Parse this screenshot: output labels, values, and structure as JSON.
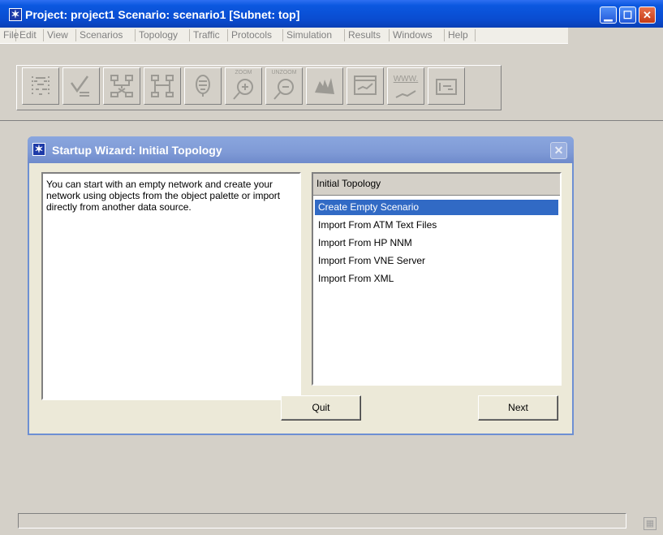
{
  "window": {
    "title": "Project: project1 Scenario: scenario1  [Subnet: top]",
    "icon": "star-icon",
    "controls": [
      "minimize-icon",
      "maximize-icon",
      "close-icon"
    ]
  },
  "menu": [
    {
      "label": "File"
    },
    {
      "label": "Edit"
    },
    {
      "label": "View"
    },
    {
      "label": "Scenarios"
    },
    {
      "label": "Topology"
    },
    {
      "label": "Traffic"
    },
    {
      "label": "Protocols"
    },
    {
      "label": "Simulation"
    },
    {
      "label": "Results"
    },
    {
      "label": "Windows"
    },
    {
      "label": "Help"
    }
  ],
  "toolbar": {
    "zoom_label": "ZOOM",
    "unzoom_label": "UNZOOM",
    "www_label": "WWW.",
    "buttons": [
      {
        "icon": "open-palette-icon"
      },
      {
        "icon": "check-links-icon"
      },
      {
        "icon": "fail-link-icon"
      },
      {
        "icon": "recover-link-icon"
      },
      {
        "icon": "return-parent-icon"
      },
      {
        "icon": "zoom-in-icon"
      },
      {
        "icon": "zoom-out-icon"
      },
      {
        "icon": "configure-simulation-icon"
      },
      {
        "icon": "view-results-icon"
      },
      {
        "icon": "web-reports-icon"
      },
      {
        "icon": "hide-graphs-icon"
      }
    ]
  },
  "dialog": {
    "title": "Startup Wizard: Initial Topology",
    "description": "You can start with an empty network and create your network using objects from the object palette or import directly from another data source.",
    "list_header": "Initial Topology",
    "options": [
      {
        "label": "Create Empty Scenario",
        "selected": true
      },
      {
        "label": "Import From ATM Text Files",
        "selected": false
      },
      {
        "label": "Import From HP NNM",
        "selected": false
      },
      {
        "label": "Import From VNE Server",
        "selected": false
      },
      {
        "label": "Import From XML",
        "selected": false
      }
    ],
    "quit_label": "Quit",
    "next_label": "Next"
  },
  "status": {
    "text": "",
    "icon": "calculator-icon"
  }
}
